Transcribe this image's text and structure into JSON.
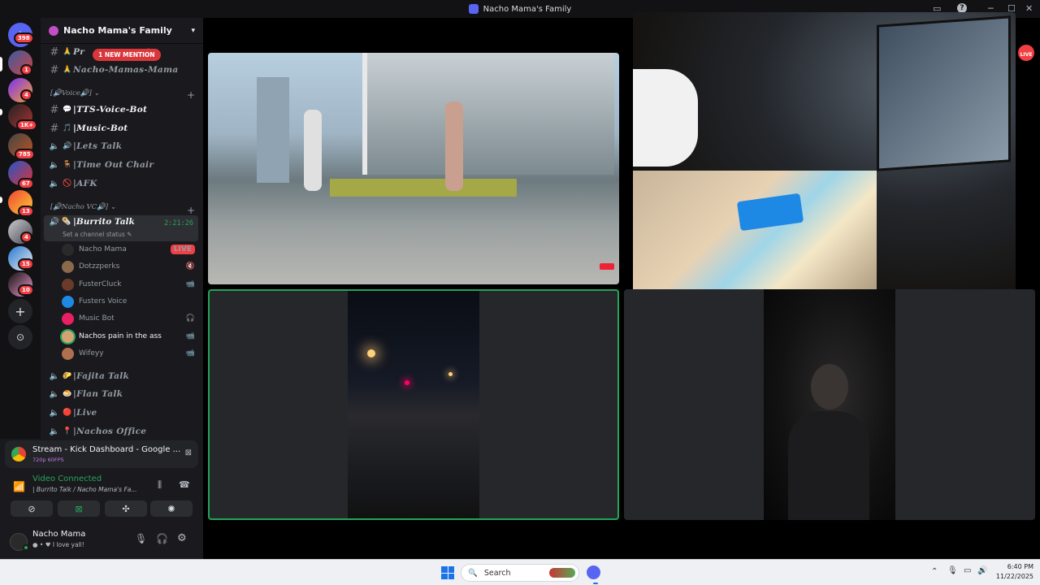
{
  "window": {
    "title": "Nacho Mama's Family"
  },
  "rail": {
    "items": [
      {
        "name": "home-button",
        "badge": "398"
      },
      {
        "name": "server-1",
        "badge": "1"
      },
      {
        "name": "server-2",
        "badge": "4"
      },
      {
        "name": "server-3",
        "badge": "1K+"
      },
      {
        "name": "server-4",
        "badge": "785"
      },
      {
        "name": "server-5",
        "badge": "67"
      },
      {
        "name": "server-6",
        "badge": "13"
      },
      {
        "name": "server-7",
        "badge": "4"
      },
      {
        "name": "server-8",
        "badge": "15"
      },
      {
        "name": "server-9",
        "badge": "10"
      }
    ]
  },
  "server": {
    "name": "Nacho Mama's Family",
    "mention": "1 NEW MENTION",
    "channels_top": [
      {
        "label": "Pr",
        "suffix": "t"
      },
      {
        "label": "Nacho-Mamas-Mama"
      }
    ],
    "voice_category": "[🔊Voice🔊]",
    "voice_channels": [
      {
        "label": "TTS-Voice-Bot",
        "emoji": "💬"
      },
      {
        "label": "Music-Bot",
        "emoji": "🎵"
      },
      {
        "label": "Lets Talk",
        "emoji": "🔊"
      },
      {
        "label": "Time Out Chair",
        "emoji": "🪑"
      },
      {
        "label": "AFK",
        "emoji": "🚫"
      }
    ],
    "vc_category": "[🔊Nacho VC🔊]",
    "active_channel": {
      "label": "Burrito Talk",
      "timer": "2:21:26",
      "status": "Set a channel status"
    },
    "users": [
      {
        "name": "Nacho Mama",
        "right": "LIVE",
        "white": false
      },
      {
        "name": "Dotzzperks",
        "right": "🔇",
        "white": false
      },
      {
        "name": "FusterCluck",
        "right": "📹",
        "white": false
      },
      {
        "name": "Fusters Voice",
        "right": "",
        "white": false
      },
      {
        "name": "Music Bot",
        "right": "🎧",
        "white": false
      },
      {
        "name": "Nachos pain in the ass",
        "right": "📹",
        "white": true
      },
      {
        "name": "Wifeyy",
        "right": "📹",
        "white": false
      }
    ],
    "more_channels": [
      {
        "label": "Fajita Talk",
        "emoji": "🌮"
      },
      {
        "label": "Flan Talk",
        "emoji": "🍮"
      },
      {
        "label": "Live",
        "emoji": "🔴"
      },
      {
        "label": "Nachos Office",
        "emoji": "📍"
      }
    ]
  },
  "stream_card": {
    "title": "Stream - Kick Dashboard - Google ...",
    "quality": "720p 60FPS"
  },
  "voice": {
    "status": "Video Connected",
    "location": "| Burrito Talk / Nacho Mama's Fa..."
  },
  "user": {
    "name": "Nacho Mama",
    "status": "I love yall!"
  },
  "stage": {
    "live_label": "LIVE"
  },
  "taskbar": {
    "search": "Search",
    "time": "6:40 PM",
    "date": "11/22/2025"
  },
  "colors": {
    "accent": "#5865f2",
    "online": "#23a55a",
    "danger": "#f23f43",
    "voice_green": "#23a55a"
  }
}
